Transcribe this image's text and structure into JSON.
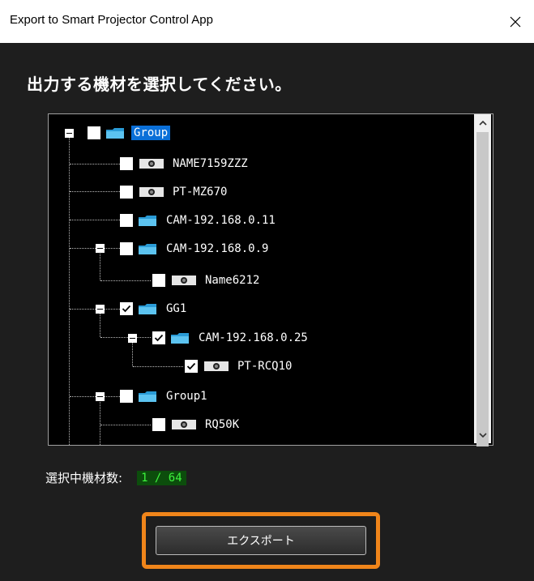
{
  "window": {
    "title": "Export to Smart Projector Control App"
  },
  "heading": "出力する機材を選択してください。",
  "tree": [
    {
      "label": "Group",
      "type": "folder",
      "checked": false,
      "selected": true,
      "expandable": true
    },
    {
      "label": "NAME7159ZZZ",
      "type": "projector",
      "checked": false
    },
    {
      "label": "PT-MZ670",
      "type": "projector",
      "checked": false
    },
    {
      "label": "CAM-192.168.0.11",
      "type": "folder",
      "checked": false
    },
    {
      "label": "CAM-192.168.0.9",
      "type": "folder",
      "checked": false,
      "expandable": true
    },
    {
      "label": "Name6212",
      "type": "projector",
      "checked": false
    },
    {
      "label": "GG1",
      "type": "folder",
      "checked": true,
      "expandable": true
    },
    {
      "label": "CAM-192.168.0.25",
      "type": "folder",
      "checked": true,
      "expandable": true
    },
    {
      "label": "PT-RCQ10",
      "type": "projector",
      "checked": true
    },
    {
      "label": "Group1",
      "type": "folder",
      "checked": false,
      "expandable": true
    },
    {
      "label": "RQ50K",
      "type": "projector",
      "checked": false
    }
  ],
  "selection": {
    "label": "選択中機材数:",
    "value": "1 / 64"
  },
  "export_button": {
    "label": "エクスポート"
  },
  "colors": {
    "highlight": "#f0851a",
    "selected_bg": "#0a6fd8",
    "count_text": "#3ef33e",
    "count_bg": "#0c4d0c"
  }
}
